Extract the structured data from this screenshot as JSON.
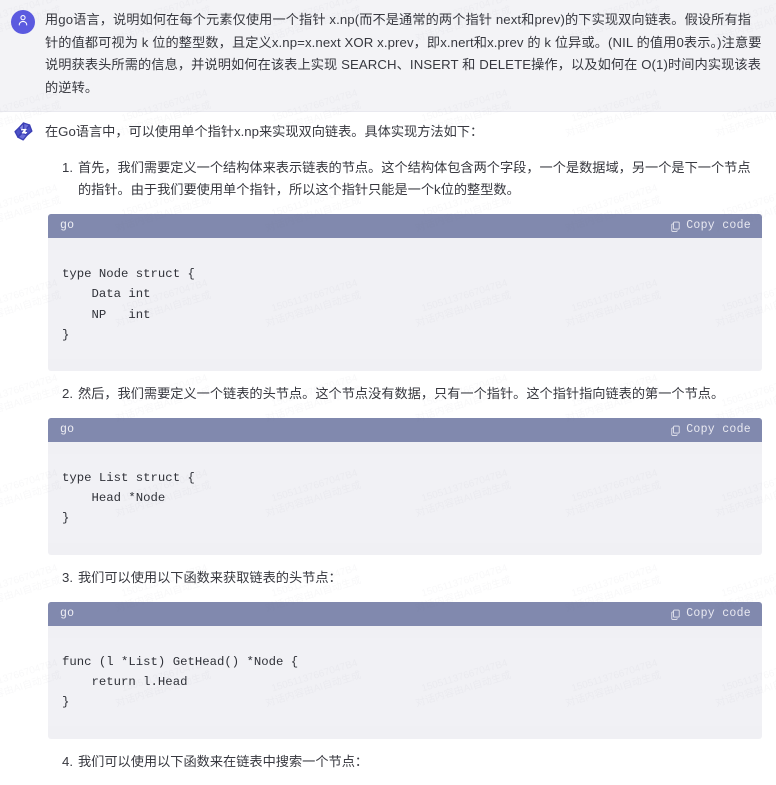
{
  "user_message": {
    "avatar_icon": "person-icon",
    "text": "用go语言，说明如何在每个元素仅使用一个指针 x.np(而不是通常的两个指针 next和prev)的下实现双向链表。假设所有指针的值都可视为 k 位的整型数，且定义x.np=x.next XOR x.prev，即x.nert和x.prev 的 k 位异或。(NIL 的值用0表示。)注意要说明获表头所需的信息，并说明如何在该表上实现 SEARCH、INSERT 和 DELETE操作，以及如何在 O(1)时间内实现该表的逆转。"
  },
  "assistant_message": {
    "avatar_icon": "assistant-logo-icon",
    "intro": "在Go语言中，可以使用单个指针x.np来实现双向链表。具体实现方法如下：",
    "steps": [
      {
        "number": "1.",
        "text": "首先，我们需要定义一个结构体来表示链表的节点。这个结构体包含两个字段，一个是数据域，另一个是下一个节点的指针。由于我们要使用单个指针，所以这个指针只能是一个k位的整型数。",
        "code": {
          "language": "go",
          "copy_label": "Copy code",
          "copy_icon": "copy-icon",
          "content": "type Node struct {\n    Data int\n    NP   int\n}"
        }
      },
      {
        "number": "2.",
        "text": "然后，我们需要定义一个链表的头节点。这个节点没有数据，只有一个指针。这个指针指向链表的第一个节点。",
        "code": {
          "language": "go",
          "copy_label": "Copy code",
          "copy_icon": "copy-icon",
          "content": "type List struct {\n    Head *Node\n}"
        }
      },
      {
        "number": "3.",
        "text": "我们可以使用以下函数来获取链表的头节点：",
        "code": {
          "language": "go",
          "copy_label": "Copy code",
          "copy_icon": "copy-icon",
          "content": "func (l *List) GetHead() *Node {\n    return l.Head\n}"
        }
      },
      {
        "number": "4.",
        "text": "我们可以使用以下函数来在链表中搜索一个节点：",
        "code": null
      }
    ]
  },
  "watermark": {
    "line1": "15051137667047B4",
    "line2": "对话内容由AI自动生成"
  },
  "colors": {
    "user_bubble_bg": "#f3f3f6",
    "assistant_bubble_bg": "#ffffff",
    "user_avatar_bg": "#5b5ae0",
    "code_header_bg": "#8189ae",
    "code_body_bg": "#f1f1f5",
    "text": "#37383f"
  }
}
